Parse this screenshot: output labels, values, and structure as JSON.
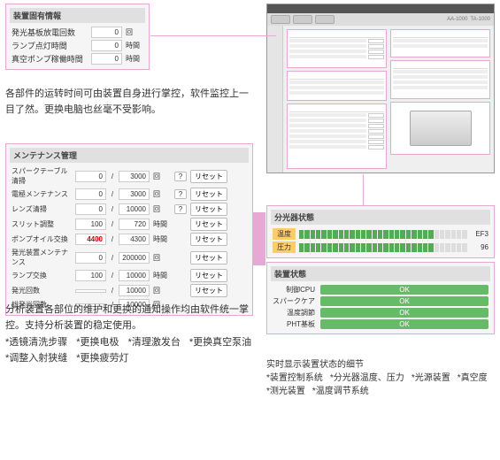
{
  "panel1": {
    "title": "装置固有情報",
    "rows": [
      {
        "label": "発光基板放電回数",
        "val": "0",
        "unit": "回"
      },
      {
        "label": "ランプ点灯時間",
        "val": "0",
        "unit": "時間"
      },
      {
        "label": "真空ポンプ稼働時間",
        "val": "0",
        "unit": "時間"
      }
    ]
  },
  "note1": "各部件的运转时间可由装置自身进行掌控，软件监控上一目了然。更换电脑也丝毫不受影响。",
  "panel2": {
    "title": "メンテナンス管理",
    "rows": [
      {
        "label": "スパークテーブル清掃",
        "v1": "0",
        "v2": "3000",
        "unit": "回",
        "q": true,
        "reset": "リセット"
      },
      {
        "label": "電極メンテナンス",
        "v1": "0",
        "v2": "3000",
        "unit": "回",
        "q": true,
        "reset": "リセット"
      },
      {
        "label": "レンズ清掃",
        "v1": "0",
        "v2": "10000",
        "unit": "回",
        "q": true,
        "reset": "リセット"
      },
      {
        "label": "スリット調整",
        "v1": "100",
        "v2": "720",
        "unit": "時間",
        "reset": "リセット"
      },
      {
        "label": "ポンプオイル交換",
        "v1": "4400",
        "v2": "4300",
        "unit": "時間",
        "reset": "リセット",
        "red": true
      },
      {
        "label": "発光装置メンテナンス",
        "v1": "0",
        "v2": "200000",
        "unit": "回",
        "reset": "リセット"
      },
      {
        "label": "ランプ交換",
        "v1": "100",
        "v2": "10000",
        "unit": "時間",
        "reset": "リセット"
      },
      {
        "label": "発光回数",
        "v1": "",
        "v2": "10000",
        "unit": "回",
        "reset": "リセット"
      },
      {
        "label": "総発光回数",
        "v1": "",
        "v2": "10000",
        "unit": "回"
      }
    ]
  },
  "note2": {
    "p": "分析装置各部位的维护和更换的通知操作均由软件统一掌控。支持分析装置的稳定使用。",
    "items": [
      "*透镜清洗步骤",
      "*更换电极",
      "*清理激发台",
      "*更换真空泵油",
      "*调整入射狭缝",
      "*更换疲劳灯"
    ]
  },
  "panel3": {
    "title": "分光器状態",
    "rows": [
      {
        "label": "温度",
        "val": "EF3"
      },
      {
        "label": "圧力",
        "val": "96"
      }
    ]
  },
  "panel4": {
    "title": "装置状態",
    "rows": [
      {
        "label": "制御CPU",
        "val": "OK"
      },
      {
        "label": "スパークケア",
        "val": "OK"
      },
      {
        "label": "温度調節",
        "val": "OK"
      },
      {
        "label": "PHT基板",
        "val": "OK"
      }
    ]
  },
  "note3": {
    "h": "实时显示装置状态的细节",
    "items": [
      "*装置控制系统",
      "*分光器温度、压力",
      "*光源装置",
      "*真空度",
      "*测光装置",
      "*温度调节系统"
    ]
  },
  "app": {
    "tabs": [
      "AA-1000",
      "TA-1000"
    ]
  }
}
